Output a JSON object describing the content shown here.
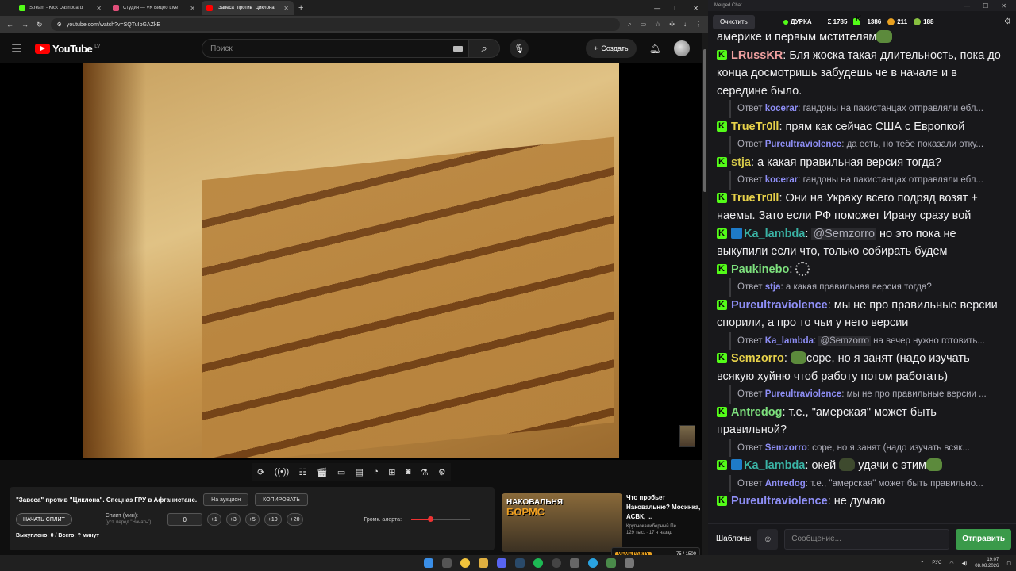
{
  "browser": {
    "tabs": [
      {
        "label": "Stream - Kick Dashboard",
        "color": "#53fc18",
        "active": false
      },
      {
        "label": "Студия — VK Видео Live",
        "color": "#e04f7a",
        "active": false
      },
      {
        "label": "\"Завеса\" против \"Циклона\"",
        "color": "#ff0000",
        "active": true
      }
    ],
    "url": "youtube.com/watch?v=SQTuIpGAZkE"
  },
  "youtube": {
    "logo_text": "YouTube",
    "region": "LV",
    "search_placeholder": "Поиск",
    "create_label": "Создать"
  },
  "panel": {
    "title": "\"Завеса\" против \"Циклона\". Спецназ ГРУ в Афганистане.",
    "auction_label": "На аукцион",
    "copy_label": "КОПИРОВАТЬ",
    "start_split_label": "НАЧАТЬ СПЛИТ",
    "split_label": "Сплит (мин):",
    "split_hint": "(уст. перед \"Начать\")",
    "split_value": "0",
    "increments": [
      "+1",
      "+3",
      "+5",
      "+10",
      "+20"
    ],
    "alert_volume_label": "Громк. алерта:",
    "alert_volume": 0.33,
    "summary": "Выкуплено: 0 / Всего: ? минут"
  },
  "recommendation": {
    "thumb_line1": "НАКОВАЛЬНЯ",
    "thumb_line2": "БОРМС",
    "title": "Что пробьет Наковальню? Мосинка, АСВК, ...",
    "channel": "Крупнокалиберный Пе...",
    "views": "129 тыс.",
    "age": "17 ч назад"
  },
  "chat": {
    "window_title": "Merged Chat",
    "clear_label": "Очистить",
    "channel": "ДУРКА",
    "total": "Σ 1785",
    "kick_count": "1386",
    "vk_count": "211",
    "yt_count": "188",
    "reply_prefix": "Ответ",
    "messages": [
      {
        "type": "msg",
        "user": "",
        "color": "#efeff1",
        "text": "америке и первым мстителям",
        "emote": true,
        "badge": false
      },
      {
        "type": "msg",
        "user": "LRussKR",
        "color": "#f0a0a0",
        "text": "Бля жоска такая длительность, пока до конца досмотришь забудешь че в начале и в середине было.",
        "badge": true
      },
      {
        "type": "reply",
        "user": "kocerar",
        "text": "гандоны на пакистанцах отправляли ебл..."
      },
      {
        "type": "msg",
        "user": "TrueTr0ll",
        "color": "#e8d24a",
        "text": "прям как сейчас США с Европкой",
        "badge": true
      },
      {
        "type": "reply",
        "user": "Pureultraviolence",
        "text": "да есть, но тебе показали отку..."
      },
      {
        "type": "msg",
        "user": "stja",
        "color": "#d6c94a",
        "text": "а какая правильная версия тогда?",
        "badge": true
      },
      {
        "type": "reply",
        "user": "kocerar",
        "text": "гандоны на пакистанцах отправляли ебл..."
      },
      {
        "type": "msg",
        "user": "TrueTr0ll",
        "color": "#e8d24a",
        "text": "Они на Украху всего подряд возят + наемы. Зато если РФ поможет Ирану сразу вой",
        "badge": true
      },
      {
        "type": "msg",
        "user": "Ka_lambda",
        "color": "#3ab3a5",
        "mention": "@Semzorro",
        "text": "но это пока не выкупили если что, только собирать будем",
        "badge": true,
        "vbadge": true
      },
      {
        "type": "msg",
        "user": "Paukinebo",
        "color": "#7de07d",
        "text": "",
        "spinner": true,
        "badge": true
      },
      {
        "type": "reply",
        "user": "stja",
        "text": "а какая правильная версия тогда?"
      },
      {
        "type": "msg",
        "user": "Pureultraviolence",
        "color": "#8e8ef5",
        "text": "мы не про правильные версии спорили, а про то чьи у него версии",
        "badge": true
      },
      {
        "type": "reply",
        "user": "Ka_lambda",
        "mention": "@Semzorro",
        "text": "на вечер нужно готовить..."
      },
      {
        "type": "msg",
        "user": "Semzorro",
        "color": "#e8d24a",
        "text": "соре, но я занят (надо изучать всякую хуйню чтоб работу потом работать)",
        "badge": true,
        "lead_emote": true
      },
      {
        "type": "reply",
        "user": "Pureultraviolence",
        "text": "мы не про правильные версии ..."
      },
      {
        "type": "msg",
        "user": "Antredog",
        "color": "#7de07d",
        "text": "т.е., \"амерская\" может быть правильной?",
        "badge": true
      },
      {
        "type": "reply",
        "user": "Semzorro",
        "text": "соре, но я занят (надо изучать всяк..."
      },
      {
        "type": "msg",
        "user": "Ka_lambda",
        "color": "#3ab3a5",
        "text": "окей",
        "tail": "удачи с этим",
        "badge": true,
        "vbadge": true
      },
      {
        "type": "reply",
        "user": "Antredog",
        "text": "т.е., \"амерская\" может быть правильно..."
      },
      {
        "type": "msg",
        "user": "Pureultraviolence",
        "color": "#8e8ef5",
        "text": "не думаю",
        "badge": true
      }
    ],
    "templates_label": "Шаблоны",
    "input_placeholder": "Сообщение...",
    "send_label": "Отправить"
  },
  "overlay": {
    "alert_name": "MEME PARTY",
    "alert_count": "75 / 1500"
  },
  "taskbar": {
    "lang": "РУС",
    "time": "19:07",
    "date": "08.08.2026"
  }
}
